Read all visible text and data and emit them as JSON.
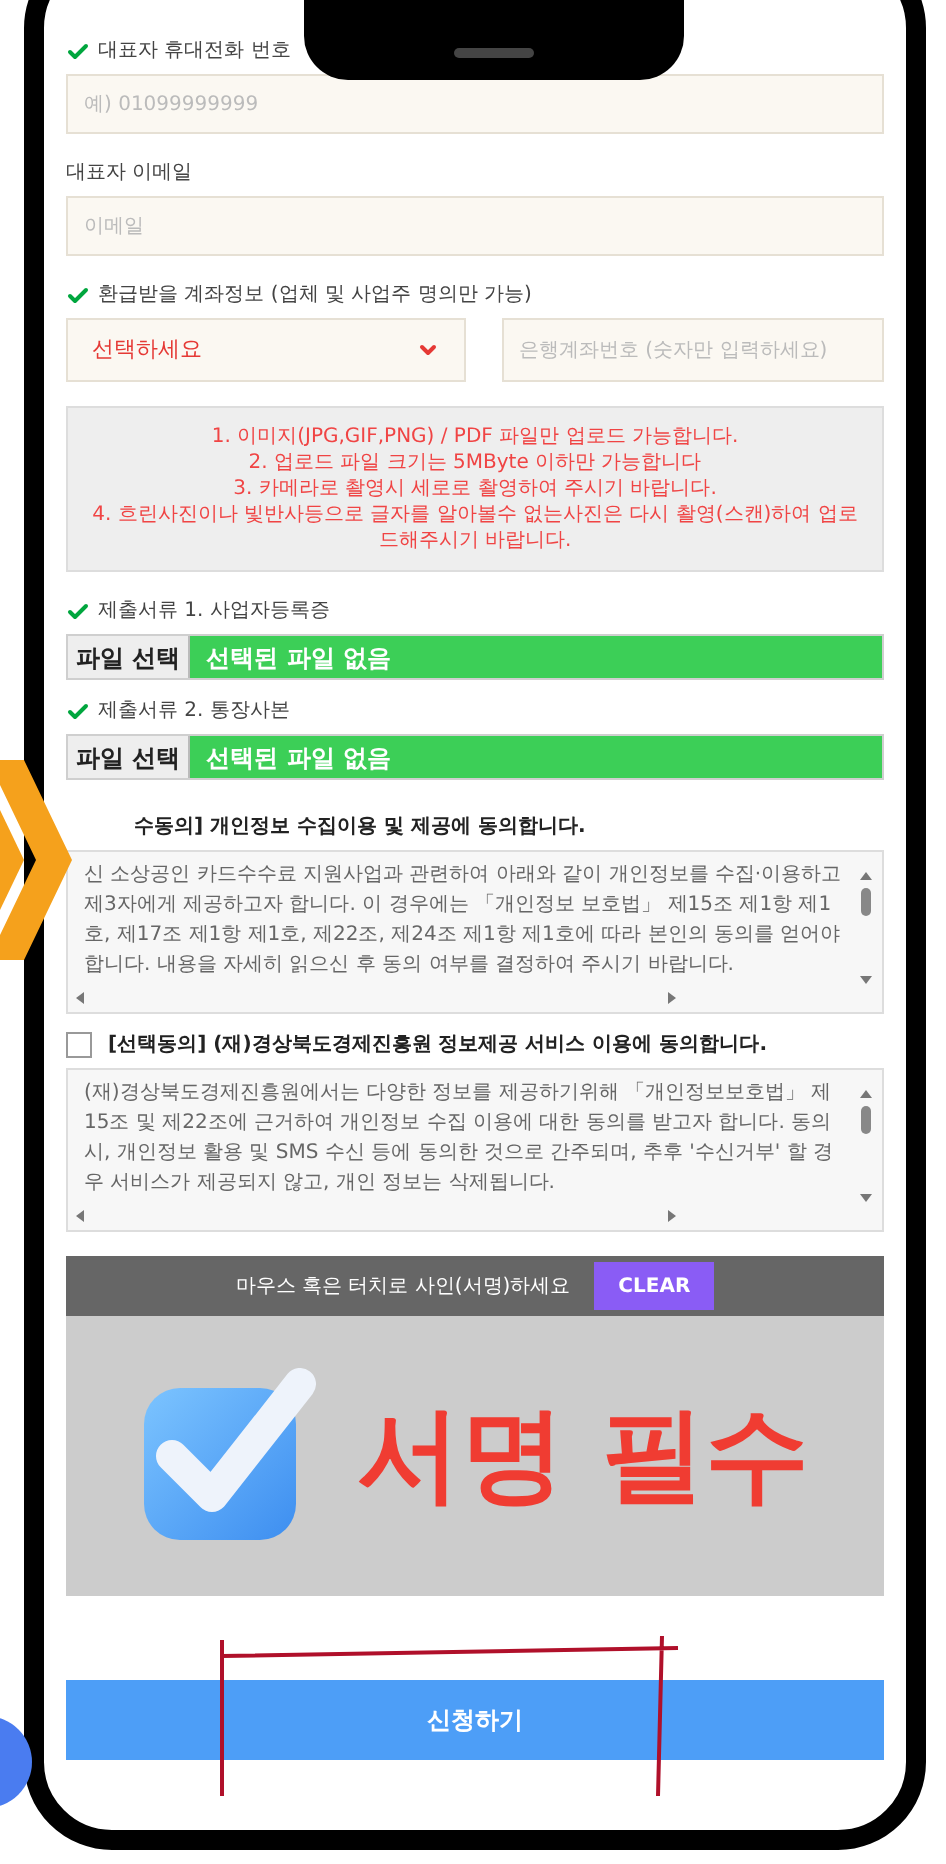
{
  "fields": [
    {
      "kind": "input",
      "label": "대표자 휴대전화 번호",
      "required": true,
      "placeholder": "예) 01099999999"
    },
    {
      "kind": "input",
      "label": "대표자 이메일",
      "required": false,
      "placeholder": "이메일"
    },
    {
      "kind": "account",
      "label": "환급받을 계좌정보 (업체 및 사업주 명의만 가능)",
      "required": true,
      "select_value": "선택하세요",
      "placeholder": "은행계좌번호 (숫자만 입력하세요)"
    }
  ],
  "upload_notice": [
    "1. 이미지(JPG,GIF,PNG) / PDF 파일만 업로드 가능합니다.",
    "2. 업로드 파일 크기는 5MByte 이하만 가능합니다",
    "3. 카메라로 촬영시 세로로 촬영하여 주시기 바랍니다.",
    "4. 흐린사진이나 빛반사등으로 글자를 알아볼수 없는사진은 다시 촬영(스캔)하여 업로드해주시기 바랍니다."
  ],
  "uploads": [
    {
      "label": "제출서류 1. 사업자등록증",
      "required": true,
      "button": "파일 선택",
      "status": "선택된 파일 없음"
    },
    {
      "label": "제출서류 2. 통장사본",
      "required": true,
      "button": "파일 선택",
      "status": "선택된 파일 없음"
    }
  ],
  "consents": [
    {
      "kind": "plain",
      "title": "수동의] 개인정보 수집이용 및 제공에 동의합니다.",
      "text": "신 소상공인 카드수수료 지원사업과 관련하여 아래와 같이 개인정보를 수집·이용하고 제3자에게 제공하고자 합니다. 이 경우에는 「개인정보 보호법」 제15조 제1항 제1호, 제17조 제1항 제1호, 제22조, 제24조 제1항 제1호에 따라 본인의 동의를 얻어야 합니다. 내용을 자세히 읽으신 후 동의 여부를 결정하여 주시기 바랍니다."
    },
    {
      "kind": "checkbox",
      "checked": false,
      "title": "[선택동의] (재)경상북도경제진흥원 정보제공 서비스 이용에 동의합니다.",
      "text": "(재)경상북도경제진흥원에서는 다양한 정보를 제공하기위해 「개인정보보호법」 제15조 및 제22조에 근거하여 개인정보 수집 이용에 대한 동의를 받고자 합니다. 동의 시, 개인정보 활용 및 SMS 수신 등에 동의한 것으로 간주되며, 추후 '수신거부' 할 경우 서비스가 제공되지 않고, 개인 정보는 삭제됩니다."
    }
  ],
  "signature": {
    "prompt": "마우스 혹은 터치로 사인(서명)하세요",
    "clear": "CLEAR",
    "overlay_text": "서명 필수"
  },
  "submit": "신청하기"
}
